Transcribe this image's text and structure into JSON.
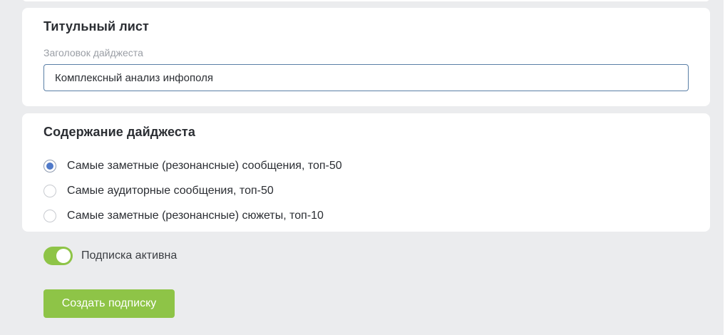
{
  "title_card": {
    "heading": "Титульный лист",
    "field_label": "Заголовок дайджеста",
    "field_value": "Комплексный анализ инфополя"
  },
  "content_card": {
    "heading": "Содержание дайджеста",
    "options": [
      {
        "label": "Самые заметные (резонансные) сообщения, топ-50",
        "selected": true
      },
      {
        "label": "Самые аудиторные сообщения, топ-50",
        "selected": false
      },
      {
        "label": "Самые заметные (резонансные) сюжеты, топ-10",
        "selected": false
      }
    ]
  },
  "subscription": {
    "toggle_label": "Подписка активна",
    "active": true
  },
  "actions": {
    "create_label": "Создать подписку"
  },
  "colors": {
    "accent_green": "#8ec447",
    "radio_blue": "#4f79c9",
    "input_border": "#5a7fa6"
  }
}
